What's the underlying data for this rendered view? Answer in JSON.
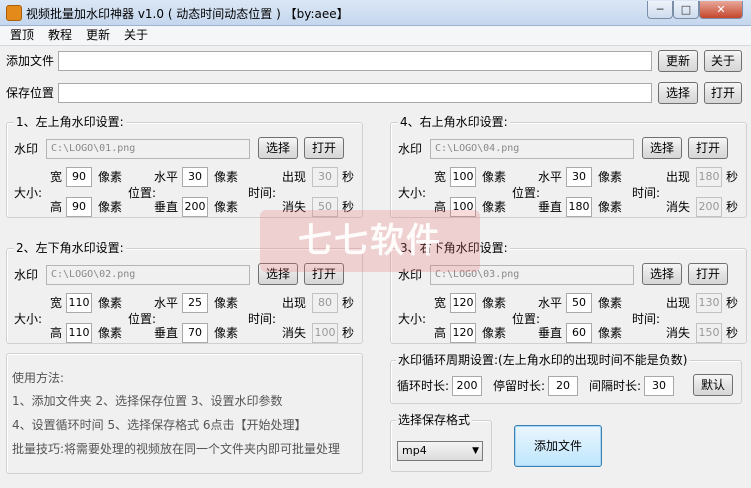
{
  "window": {
    "title": "视频批量加水印神器 v1.0 ( 动态时间动态位置 ) 【by:aee】",
    "min_glyph": "─",
    "max_glyph": "□",
    "close_glyph": "✕"
  },
  "menu": [
    "置顶",
    "教程",
    "更新",
    "关于"
  ],
  "add_file": {
    "label": "添加文件",
    "value": "",
    "btn_update": "更新",
    "btn_about": "关于"
  },
  "save_location": {
    "label": "保存位置",
    "value": "",
    "btn_select": "选择",
    "btn_open": "打开"
  },
  "common": {
    "watermark": "水印",
    "select": "选择",
    "open": "打开",
    "width": "宽",
    "height": "高",
    "size": "大小:",
    "pixel": "像素",
    "horizontal": "水平",
    "vertical": "垂直",
    "position": "位置:",
    "time": "时间:",
    "appear": "出现",
    "disappear": "消失",
    "second": "秒"
  },
  "groups": [
    {
      "title": "1、左上角水印设置:",
      "file": "C:\\LOGO\\01.png",
      "width": "90",
      "height": "90",
      "h": "30",
      "v": "200",
      "appear": "30",
      "disappear": "50"
    },
    {
      "title": "4、右上角水印设置:",
      "file": "C:\\LOGO\\04.png",
      "width": "100",
      "height": "100",
      "h": "30",
      "v": "180",
      "appear": "180",
      "disappear": "200"
    },
    {
      "title": "2、左下角水印设置:",
      "file": "C:\\LOGO\\02.png",
      "width": "110",
      "height": "110",
      "h": "25",
      "v": "70",
      "appear": "80",
      "disappear": "100"
    },
    {
      "title": "3、右下角水印设置:",
      "file": "C:\\LOGO\\03.png",
      "width": "120",
      "height": "120",
      "h": "50",
      "v": "60",
      "appear": "130",
      "disappear": "150"
    }
  ],
  "usage": {
    "title": "使用方法:",
    "line1": "1、添加文件夹    2、选择保存位置    3、设置水印参数",
    "line2": "4、设置循环时间    5、选择保存格式    6点击【开始处理】",
    "tip": "批量技巧:将需要处理的视频放在同一个文件夹内即可批量处理"
  },
  "cycle": {
    "title": "水印循环周期设置:(左上角水印的出现时间不能是负数)",
    "loop_label": "循环时长:",
    "loop_value": "200",
    "stay_label": "停留时长:",
    "stay_value": "20",
    "interval_label": "间隔时长:",
    "interval_value": "30",
    "default_btn": "默认"
  },
  "format": {
    "title": "选择保存格式",
    "selected": "mp4"
  },
  "start_button": "添加文件",
  "watermark_overlay": "七七软件"
}
